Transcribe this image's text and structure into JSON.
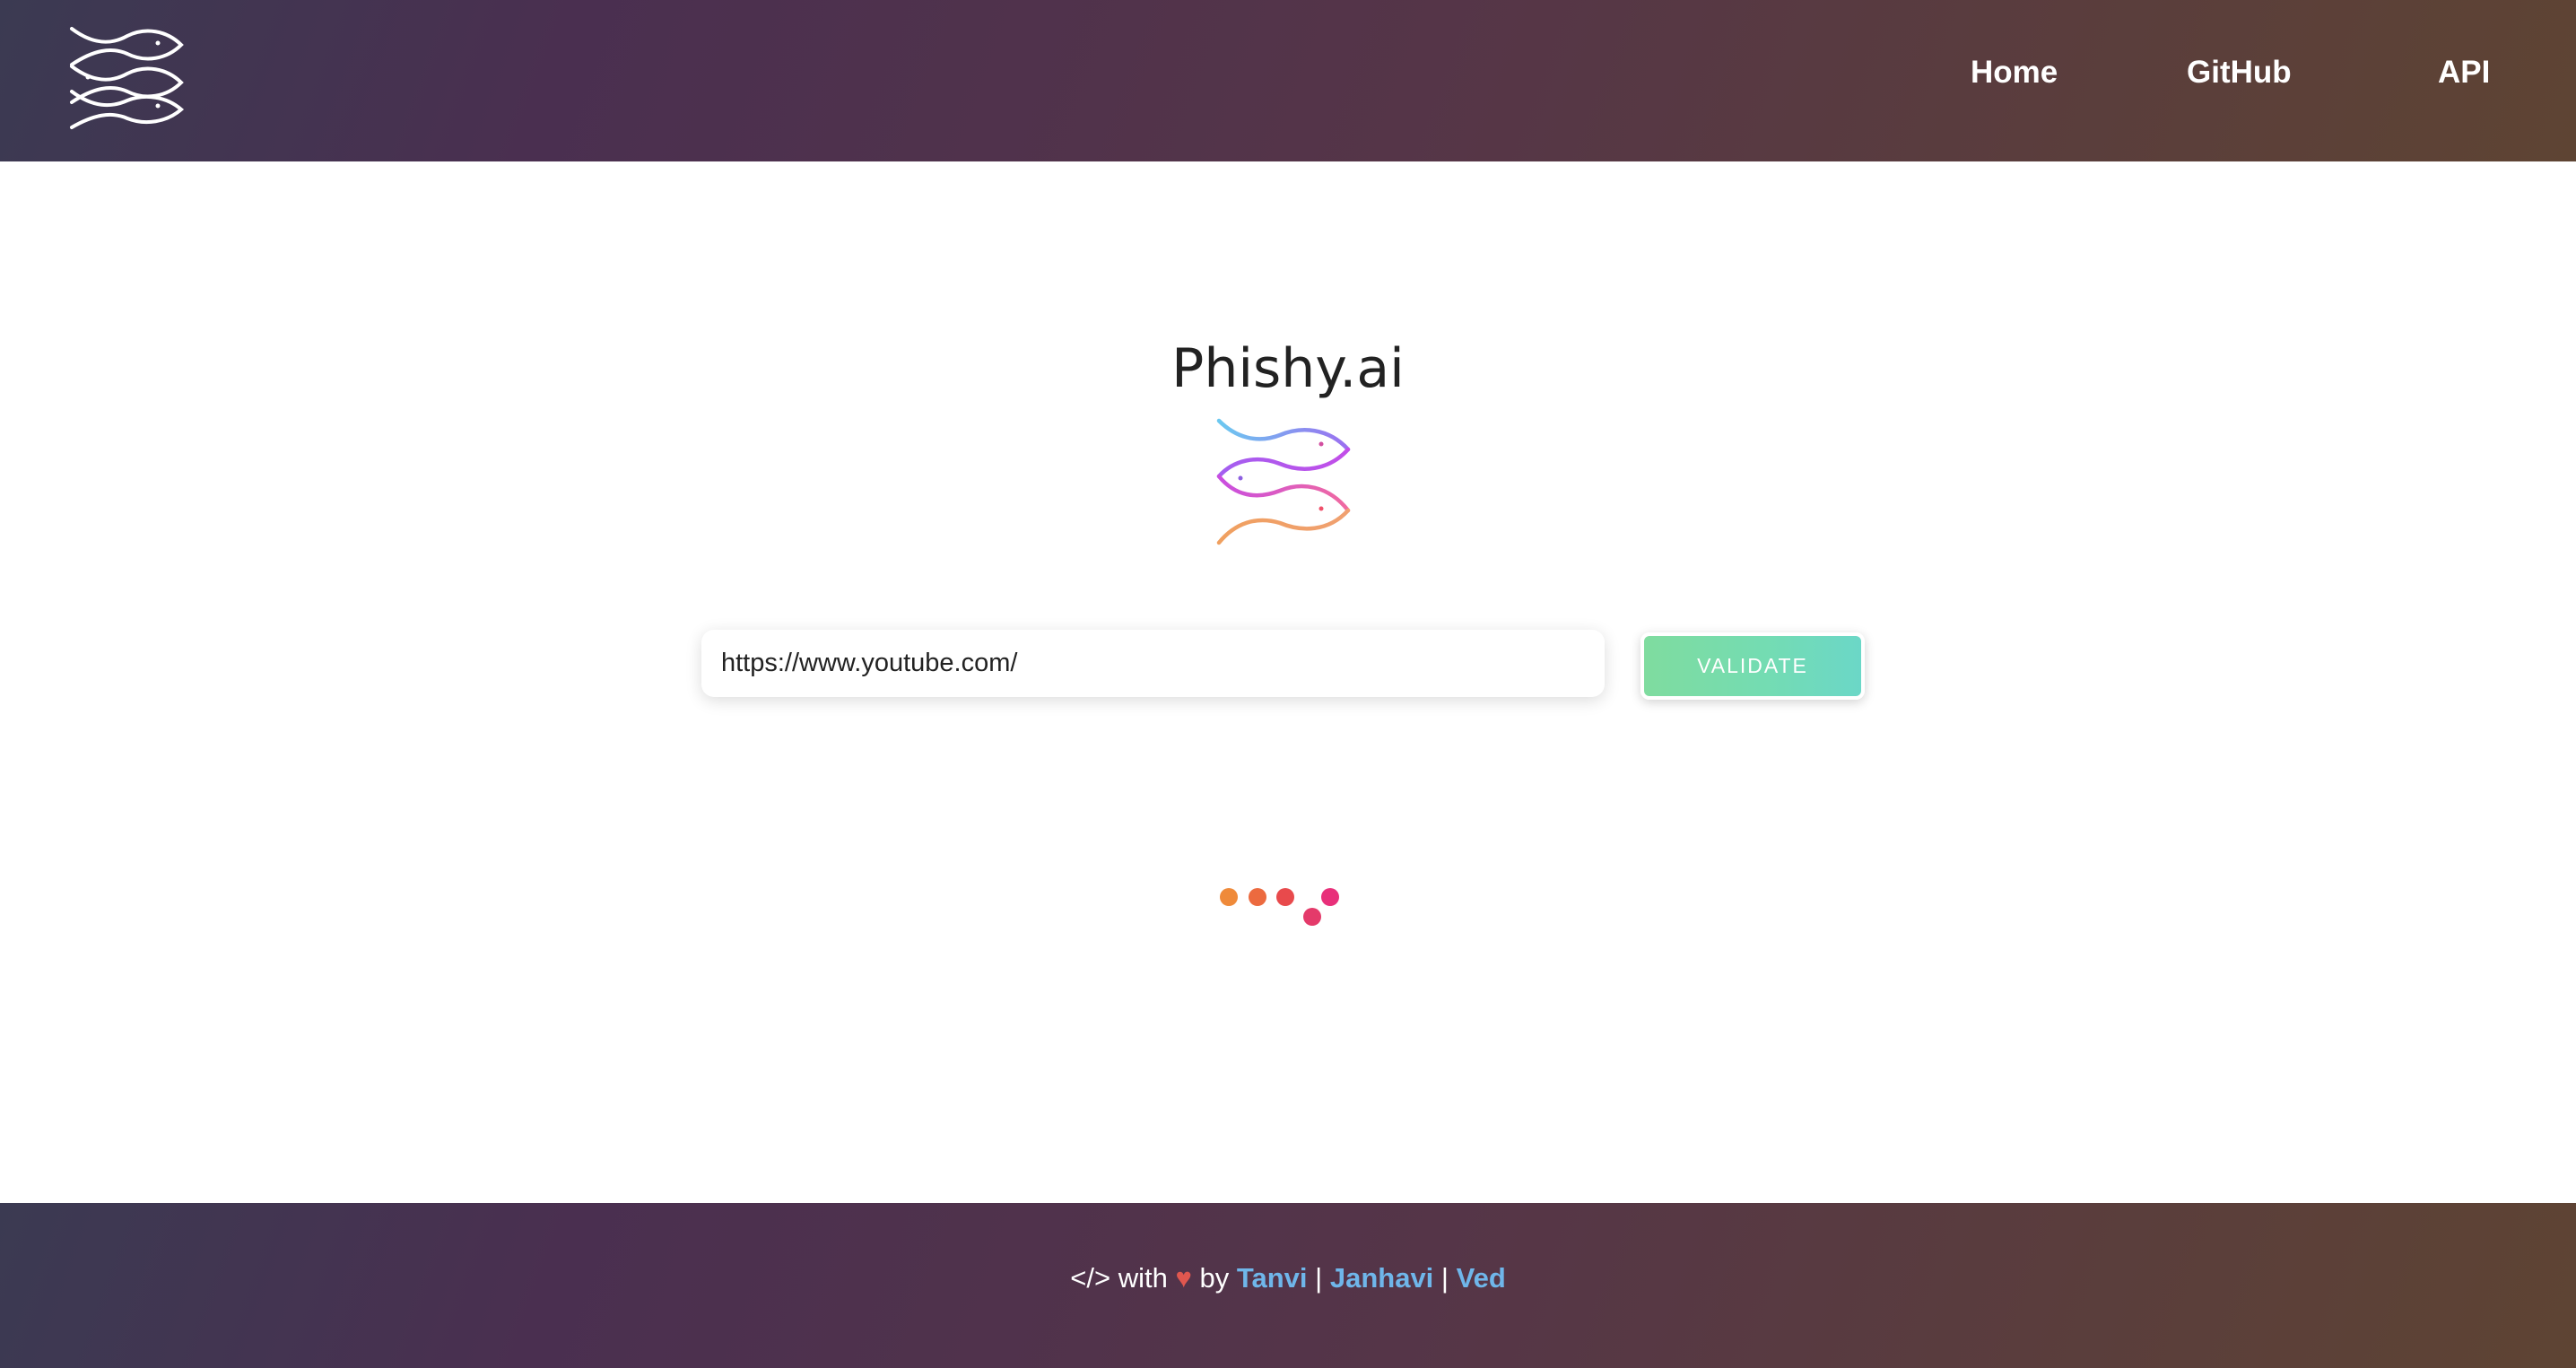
{
  "header": {
    "logo_icon": "fish-logo-icon",
    "nav": {
      "home": "Home",
      "github": "GitHub",
      "api": "API"
    }
  },
  "main": {
    "title": "Phishy.ai",
    "center_logo_icon": "colorful-fish-logo-icon",
    "url_input": {
      "value": "https://www.youtube.com/",
      "placeholder": ""
    },
    "validate_label": "VALIDATE",
    "loader_icon": "loading-dots-icon",
    "loader_colors": [
      "#ef8a3a",
      "#ec6a3f",
      "#e84a4c",
      "#e43a6a",
      "#e8307a"
    ]
  },
  "footer": {
    "code_symbol": "</>",
    "with_text": "with",
    "heart": "♥",
    "by_text": "by",
    "authors": [
      "Tanvi",
      "Janhavi",
      "Ved"
    ],
    "separator": "|"
  },
  "colors": {
    "header_gradient_start": "#3b3a52",
    "header_gradient_end": "#5e4433",
    "link_blue": "#6fb6ea",
    "button_green": "#7fdc9f",
    "button_teal": "#6bd7c7"
  }
}
